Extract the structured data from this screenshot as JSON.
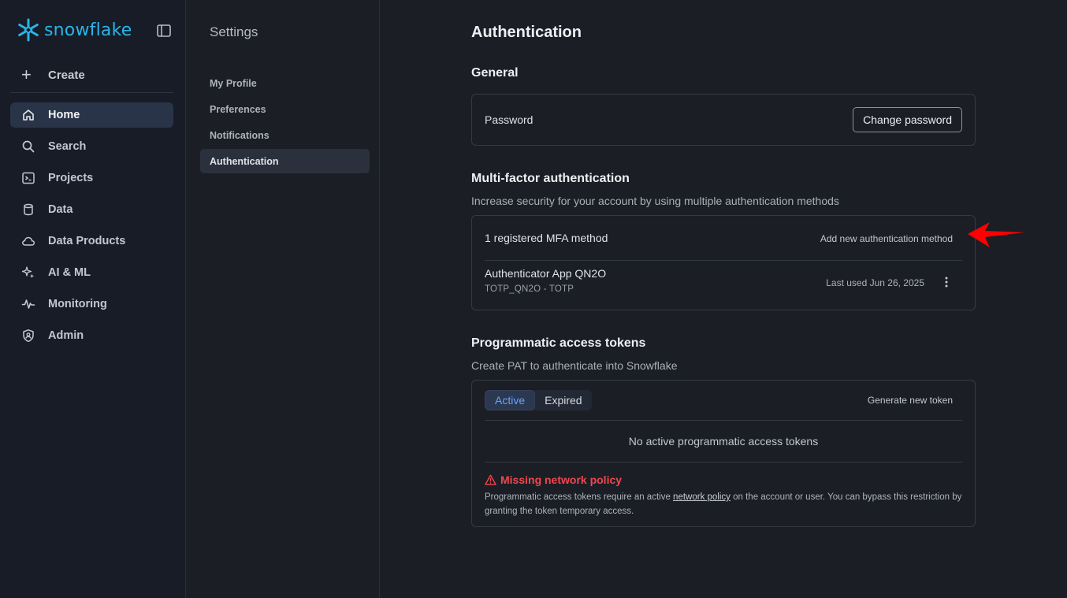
{
  "brand": {
    "name": "snowflake",
    "color": "#29b5e8"
  },
  "sidebar": {
    "create_label": "Create",
    "items": [
      {
        "label": "Home",
        "icon": "home-icon",
        "active": true
      },
      {
        "label": "Search",
        "icon": "search-icon"
      },
      {
        "label": "Projects",
        "icon": "terminal-icon"
      },
      {
        "label": "Data",
        "icon": "database-icon"
      },
      {
        "label": "Data Products",
        "icon": "cloud-icon"
      },
      {
        "label": "AI & ML",
        "icon": "sparkle-icon"
      },
      {
        "label": "Monitoring",
        "icon": "pulse-icon"
      },
      {
        "label": "Admin",
        "icon": "shield-icon"
      }
    ]
  },
  "settings": {
    "title": "Settings",
    "items": [
      {
        "label": "My Profile"
      },
      {
        "label": "Preferences"
      },
      {
        "label": "Notifications"
      },
      {
        "label": "Authentication",
        "active": true
      }
    ]
  },
  "main": {
    "title": "Authentication",
    "general": {
      "title": "General",
      "password_label": "Password",
      "change_password_label": "Change password"
    },
    "mfa": {
      "title": "Multi-factor authentication",
      "subtitle": "Increase security for your account by using multiple authentication methods",
      "count_label": "1 registered MFA method",
      "add_label": "Add new authentication method",
      "method": {
        "name": "Authenticator App QN2O",
        "sub": "TOTP_QN2O - TOTP",
        "last_used": "Last used Jun 26, 2025"
      }
    },
    "pat": {
      "title": "Programmatic access tokens",
      "subtitle": "Create PAT to authenticate into Snowflake",
      "tabs": [
        {
          "label": "Active",
          "active": true
        },
        {
          "label": "Expired"
        }
      ],
      "generate_label": "Generate new token",
      "empty_label": "No active programmatic access tokens",
      "warning": {
        "title": "Missing network policy",
        "body_before": "Programmatic access tokens require an active ",
        "link": "network policy",
        "body_after": " on the account or user. You can bypass this restriction by granting the token temporary access."
      }
    }
  },
  "colors": {
    "warning": "#f0474f",
    "annotation_arrow": "#ff0000",
    "active_tab": "#6aa2ff"
  }
}
